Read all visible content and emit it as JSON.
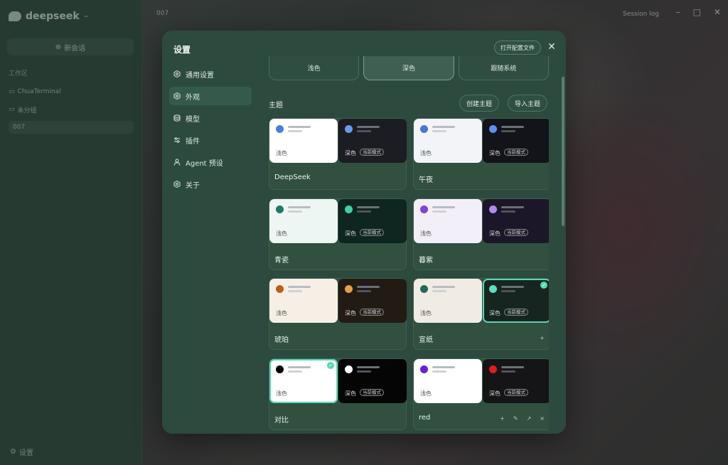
{
  "app": {
    "brand": "deepseek",
    "brand_badge": "",
    "new_chat": "新会话",
    "workspace_label": "工作区",
    "tree": [
      {
        "label": "ChuaTerminal"
      },
      {
        "label": "未分组"
      },
      {
        "label": "007",
        "meta": ""
      }
    ],
    "settings": "设置",
    "top_tab": "007",
    "top_user": "Session log",
    "status": [
      "",
      "",
      ""
    ]
  },
  "modal": {
    "title": "设置",
    "open_config": "打开配置文件",
    "close": "✕",
    "nav": [
      {
        "label": "通用设置",
        "icon": "gear-icon"
      },
      {
        "label": "外观",
        "icon": "gear-icon"
      },
      {
        "label": "模型",
        "icon": "database-icon"
      },
      {
        "label": "插件",
        "icon": "sliders-icon"
      },
      {
        "label": "Agent 预设",
        "icon": "agent-icon"
      },
      {
        "label": "关于",
        "icon": "gear-icon"
      }
    ],
    "active_nav": 1,
    "modes": [
      {
        "label": "浅色"
      },
      {
        "label": "深色"
      },
      {
        "label": "跟随系统"
      }
    ],
    "active_mode": 1,
    "themes_label": "主题",
    "create_theme": "创建主题",
    "import_theme": "导入主题",
    "light_label": "浅色",
    "dark_label": "深色",
    "current_badge": "当前模式",
    "themes": [
      {
        "name": "DeepSeek",
        "light_bg": "#ffffff",
        "dark_bg": "#1b1d22",
        "accent_light": "#4a7ee0",
        "accent_dark": "#6a9af0"
      },
      {
        "name": "午夜",
        "light_bg": "#f2f4f8",
        "dark_bg": "#12141a",
        "accent_light": "#4a74d6",
        "accent_dark": "#5d8ff0"
      },
      {
        "name": "青瓷",
        "light_bg": "#eef6f3",
        "dark_bg": "#0f2520",
        "accent_light": "#1f7a66",
        "accent_dark": "#3fcfa7"
      },
      {
        "name": "暮紫",
        "light_bg": "#f3eff9",
        "dark_bg": "#1b1628",
        "accent_light": "#7c45d6",
        "accent_dark": "#b08af2"
      },
      {
        "name": "琥珀",
        "light_bg": "#f6efe5",
        "dark_bg": "#221b14",
        "accent_light": "#b8601a",
        "accent_dark": "#e6a04a"
      },
      {
        "name": "宣纸",
        "light_bg": "#f1ece3",
        "dark_bg": "#16251f",
        "accent_light": "#1f6a58",
        "accent_dark": "#5de0c0",
        "selected_dark": true,
        "actions": [
          "+"
        ]
      },
      {
        "name": "对比",
        "light_bg": "#ffffff",
        "dark_bg": "#050505",
        "accent_light": "#000000",
        "accent_dark": "#ffffff",
        "selected_light": true
      },
      {
        "name": "red",
        "light_bg": "#ffffff",
        "dark_bg": "#151517",
        "accent_light": "#6b1ce0",
        "accent_dark": "#e01c1c",
        "actions": [
          "+",
          "✎",
          "↗",
          "×"
        ]
      }
    ]
  }
}
